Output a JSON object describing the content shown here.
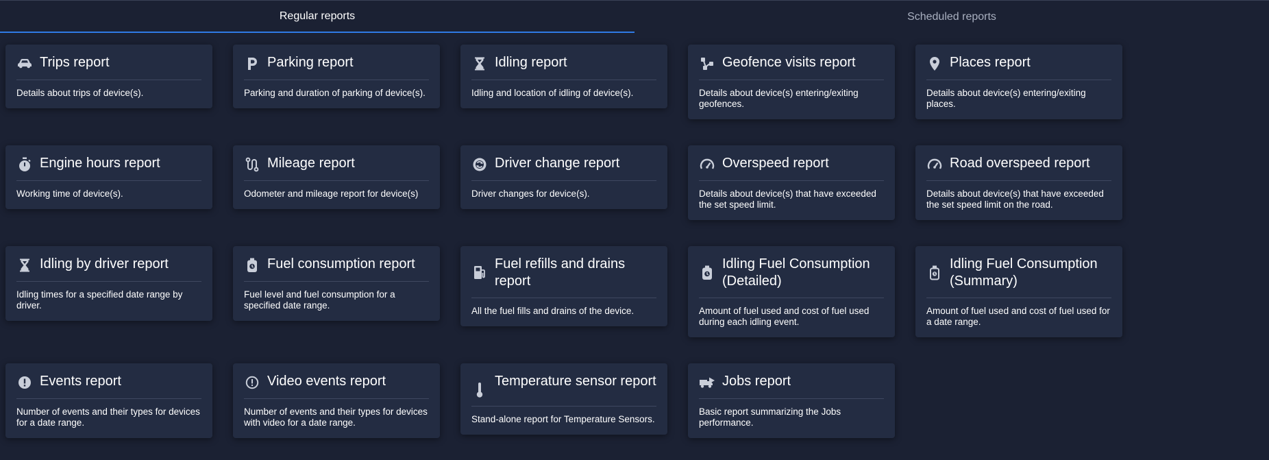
{
  "tabs": {
    "regular": "Regular reports",
    "scheduled": "Scheduled reports"
  },
  "colors": {
    "background": "#1b2133",
    "card": "#232c42",
    "accent": "#2f7be6",
    "icon": "#c9ced9"
  },
  "reports": [
    {
      "title": "Trips report",
      "desc": "Details about trips of device(s).",
      "icon": "car-icon"
    },
    {
      "title": "Parking report",
      "desc": "Parking and duration of parking of device(s).",
      "icon": "parking-icon"
    },
    {
      "title": "Idling report",
      "desc": "Idling and location of idling of device(s).",
      "icon": "hourglass-icon"
    },
    {
      "title": "Geofence visits report",
      "desc": "Details about device(s) entering/exiting geofences.",
      "icon": "geofence-icon"
    },
    {
      "title": "Places report",
      "desc": "Details about device(s) entering/exiting places.",
      "icon": "location-pin-icon"
    },
    {
      "title": "Engine hours report",
      "desc": "Working time of device(s).",
      "icon": "stopwatch-icon"
    },
    {
      "title": "Mileage report",
      "desc": "Odometer and mileage report for device(s)",
      "icon": "route-icon"
    },
    {
      "title": "Driver change report",
      "desc": "Driver changes for device(s).",
      "icon": "driver-swap-icon"
    },
    {
      "title": "Overspeed report",
      "desc": "Details about device(s) that have exceeded the set speed limit.",
      "icon": "speedometer-icon"
    },
    {
      "title": "Road overspeed report",
      "desc": "Details about device(s) that have exceeded the set speed limit on the road.",
      "icon": "speedometer-icon"
    },
    {
      "title": "Idling by driver report",
      "desc": "Idling times for a specified date range by driver.",
      "icon": "hourglass-icon"
    },
    {
      "title": "Fuel consumption report",
      "desc": "Fuel level and fuel consumption for a specified date range.",
      "icon": "fuel-can-icon"
    },
    {
      "title": "Fuel refills and drains report",
      "desc": "All the fuel fills and drains of the device.",
      "icon": "gas-pump-icon"
    },
    {
      "title": "Idling Fuel Consumption (Detailed)",
      "desc": "Amount of fuel used and cost of fuel used during each idling event.",
      "icon": "fuel-can-icon"
    },
    {
      "title": "Idling Fuel Consumption (Summary)",
      "desc": "Amount of fuel used and cost of fuel used for a date range.",
      "icon": "fuel-can-outline-icon"
    },
    {
      "title": "Events report",
      "desc": "Number of events and their types for devices for a date range.",
      "icon": "alert-circle-icon"
    },
    {
      "title": "Video events report",
      "desc": "Number of events and their types for devices with video for a date range.",
      "icon": "alert-circle-outline-icon"
    },
    {
      "title": "Temperature sensor report",
      "desc": "Stand-alone report for Temperature Sensors.",
      "icon": "thermometer-icon"
    },
    {
      "title": "Jobs report",
      "desc": "Basic report summarizing the Jobs performance.",
      "icon": "jobs-truck-icon"
    }
  ]
}
